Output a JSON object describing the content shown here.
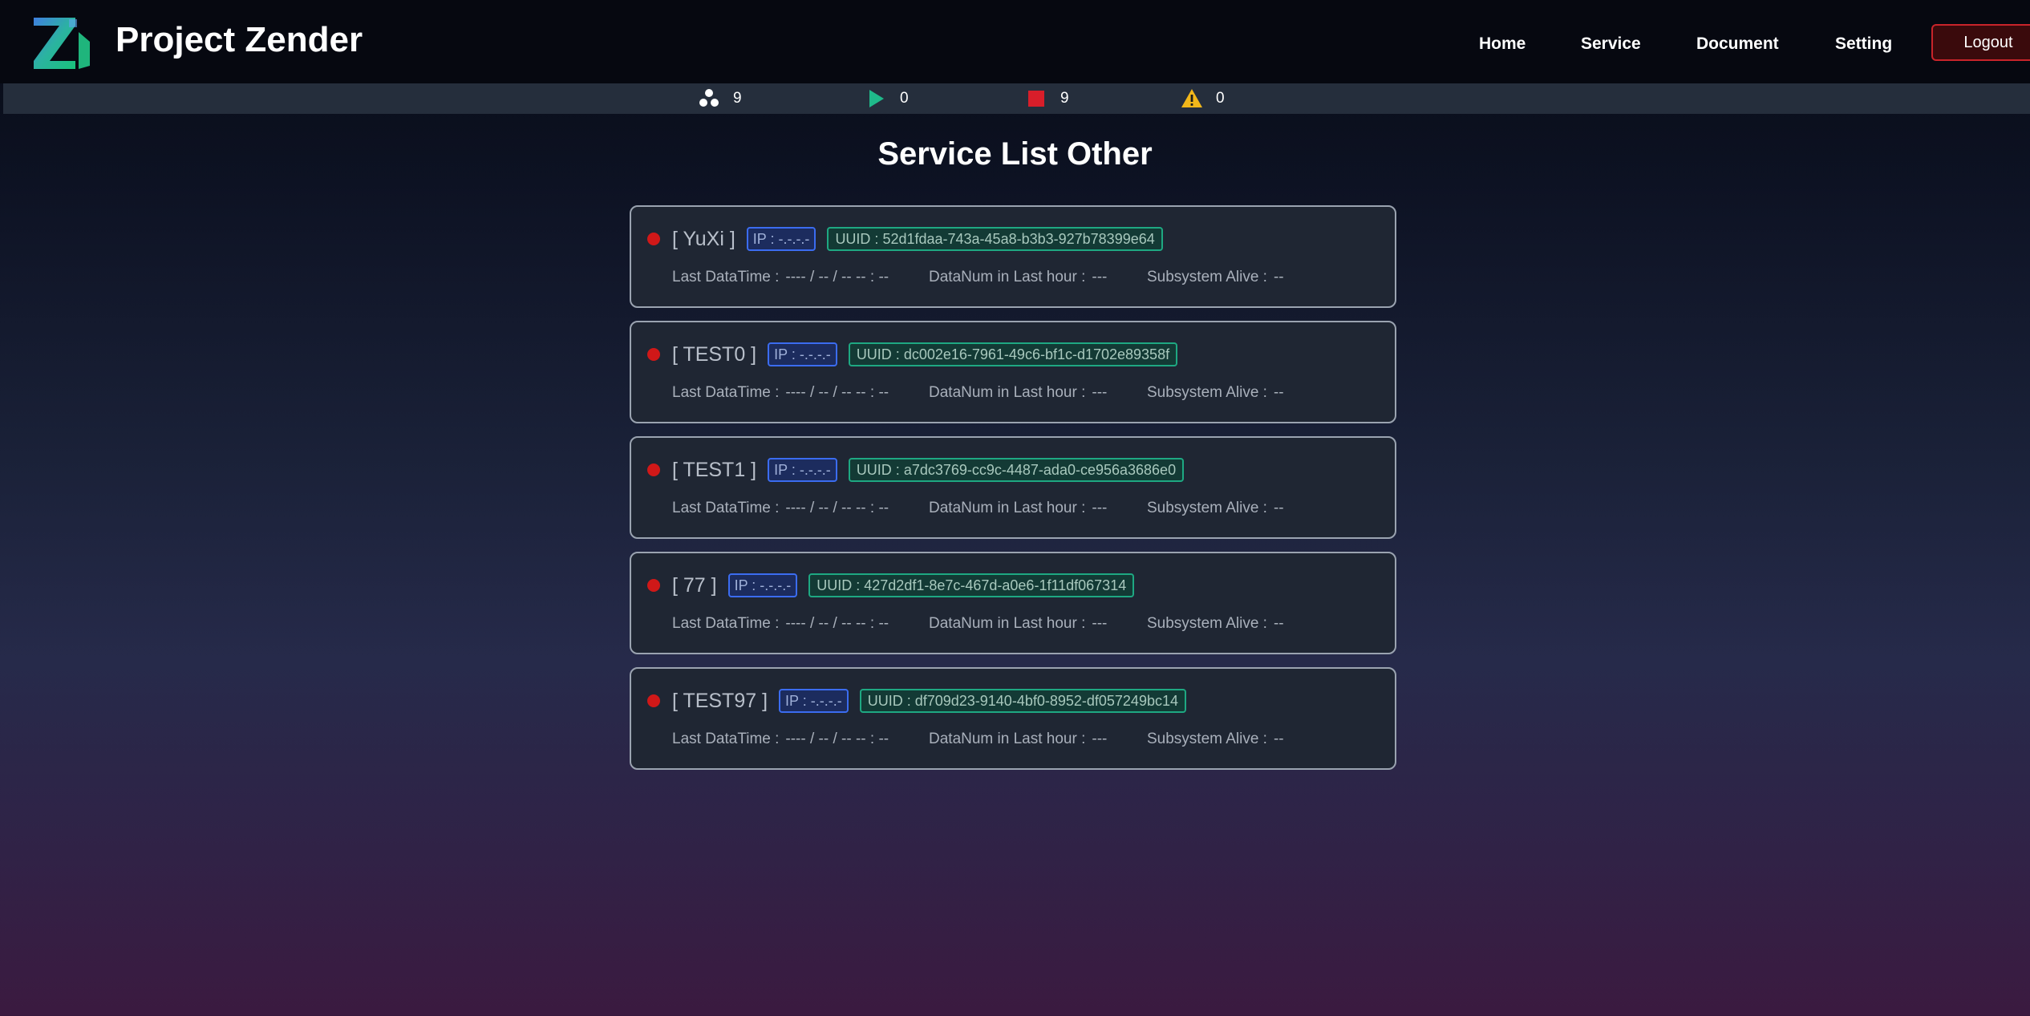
{
  "app": {
    "title": "Project Zender",
    "logo_icon": "zender-z-logo-icon"
  },
  "nav": {
    "home": "Home",
    "service": "Service",
    "document": "Document",
    "setting": "Setting",
    "logout": "Logout"
  },
  "status_bar": {
    "services": {
      "icon": "services-cluster-icon",
      "count": "9"
    },
    "running": {
      "icon": "play-icon",
      "count": "0",
      "color": "#1fb98a"
    },
    "stopped": {
      "icon": "stop-icon",
      "count": "9",
      "color": "#d81e2a"
    },
    "warning": {
      "icon": "warning-icon",
      "count": "0",
      "color": "#f2b71a"
    }
  },
  "page": {
    "title": "Service List Other"
  },
  "labels": {
    "last_datetime": "Last DataTime :",
    "datanum": "DataNum in Last hour :",
    "subsystem": "Subsystem Alive :"
  },
  "colors": {
    "status_dot_stopped": "#d01818",
    "ip_badge_border": "#3b6cf0",
    "uuid_badge_border": "#1ea882",
    "logout_border": "#c8242a"
  },
  "services": [
    {
      "name": "[ YuXi ]",
      "ip": "IP : -.-.-.-",
      "uuid": "UUID : 52d1fdaa-743a-45a8-b3b3-927b78399e64",
      "last_datetime": "---- / -- / -- -- : --",
      "datanum": "---",
      "subsystem": "--"
    },
    {
      "name": "[ TEST0 ]",
      "ip": "IP : -.-.-.-",
      "uuid": "UUID : dc002e16-7961-49c6-bf1c-d1702e89358f",
      "last_datetime": "---- / -- / -- -- : --",
      "datanum": "---",
      "subsystem": "--"
    },
    {
      "name": "[ TEST1 ]",
      "ip": "IP : -.-.-.-",
      "uuid": "UUID : a7dc3769-cc9c-4487-ada0-ce956a3686e0",
      "last_datetime": "---- / -- / -- -- : --",
      "datanum": "---",
      "subsystem": "--"
    },
    {
      "name": "[ 77 ]",
      "ip": "IP : -.-.-.-",
      "uuid": "UUID : 427d2df1-8e7c-467d-a0e6-1f11df067314",
      "last_datetime": "---- / -- / -- -- : --",
      "datanum": "---",
      "subsystem": "--"
    },
    {
      "name": "[ TEST97 ]",
      "ip": "IP : -.-.-.-",
      "uuid": "UUID : df709d23-9140-4bf0-8952-df057249bc14",
      "last_datetime": "---- / -- / -- -- : --",
      "datanum": "---",
      "subsystem": "--"
    }
  ]
}
